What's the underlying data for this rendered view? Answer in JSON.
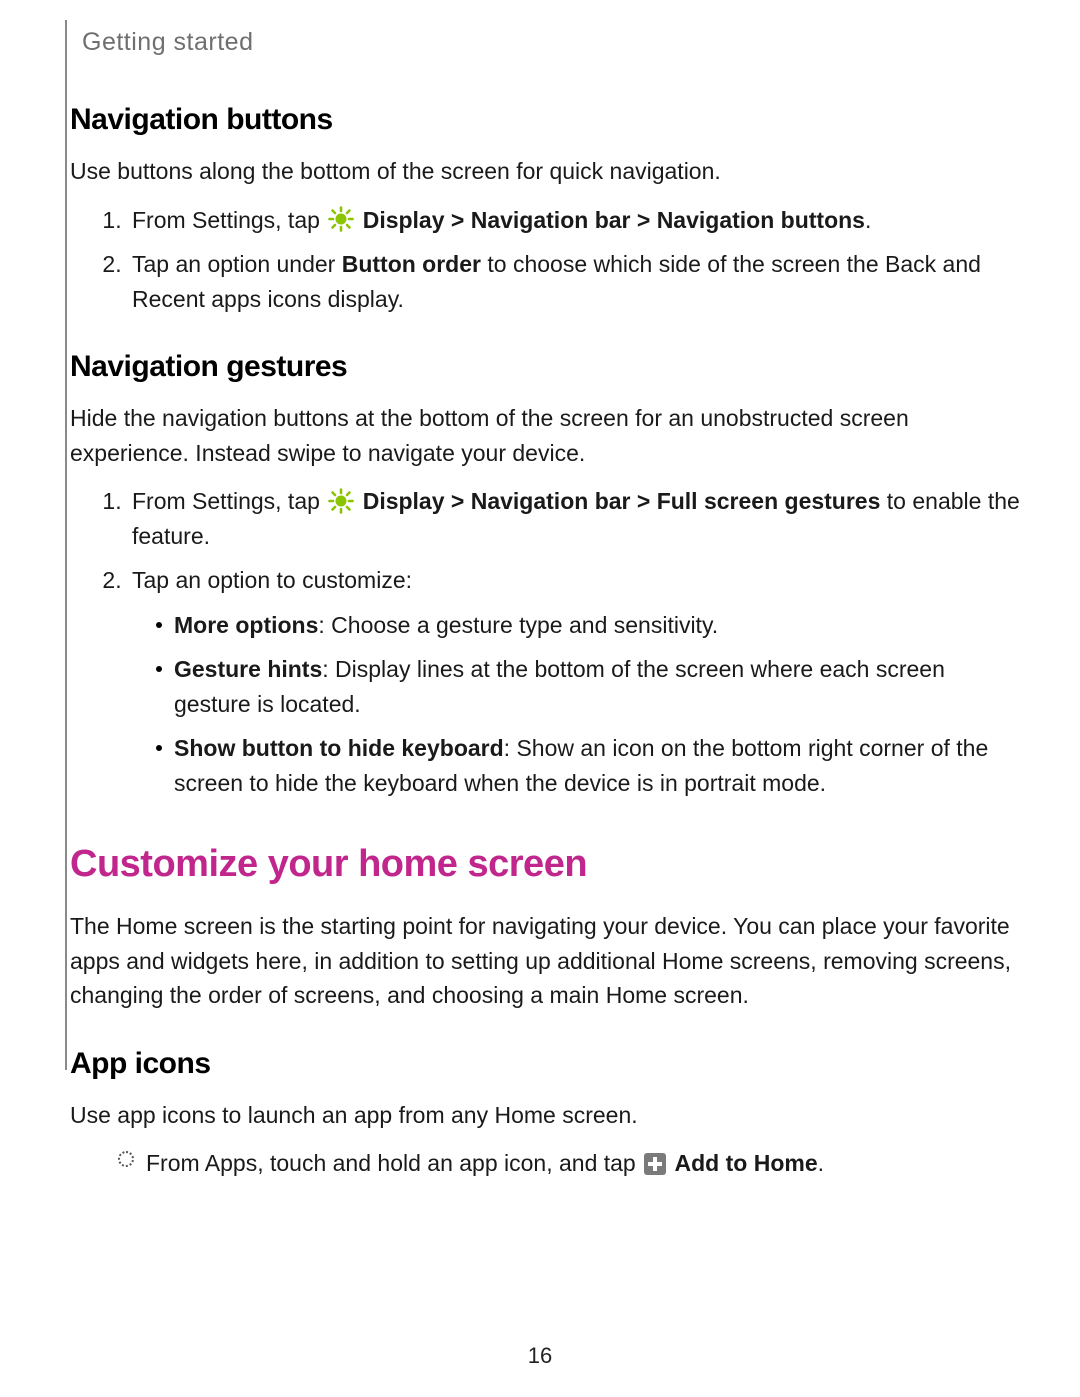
{
  "header": {
    "section": "Getting started"
  },
  "s1": {
    "title": "Navigation buttons",
    "intro": "Use buttons along the bottom of the screen for quick navigation.",
    "step1_pre": "From Settings, tap ",
    "step1_bold": "Display > Navigation bar > Navigation buttons",
    "step1_post": ".",
    "step2_pre": "Tap an option under ",
    "step2_bold": "Button order",
    "step2_post": " to choose which side of the screen the Back and Recent apps icons display."
  },
  "s2": {
    "title": "Navigation gestures",
    "intro": "Hide the navigation buttons at the bottom of the screen for an unobstructed screen experience. Instead swipe to navigate your device.",
    "step1_pre": "From Settings, tap ",
    "step1_bold": "Display > Navigation bar > Full screen gestures",
    "step1_post": " to enable the feature.",
    "step2": "Tap an option to customize:",
    "b1_bold": "More options",
    "b1_rest": ": Choose a gesture type and sensitivity.",
    "b2_bold": "Gesture hints",
    "b2_rest": ": Display lines at the bottom of the screen where each screen gesture is located.",
    "b3_bold": "Show button to hide keyboard",
    "b3_rest": ": Show an icon on the bottom right corner of the screen to hide the keyboard when the device is in portrait mode."
  },
  "s3": {
    "title": "Customize your home screen",
    "intro": "The Home screen is the starting point for navigating your device. You can place your favorite apps and widgets here, in addition to setting up additional Home screens, removing screens, changing the order of screens, and choosing a main Home screen."
  },
  "s4": {
    "title": "App icons",
    "intro": "Use app icons to launch an app from any Home screen.",
    "step_pre": "From Apps, touch and hold an app icon, and tap ",
    "step_bold": "Add to Home",
    "step_post": "."
  },
  "page_number": "16"
}
